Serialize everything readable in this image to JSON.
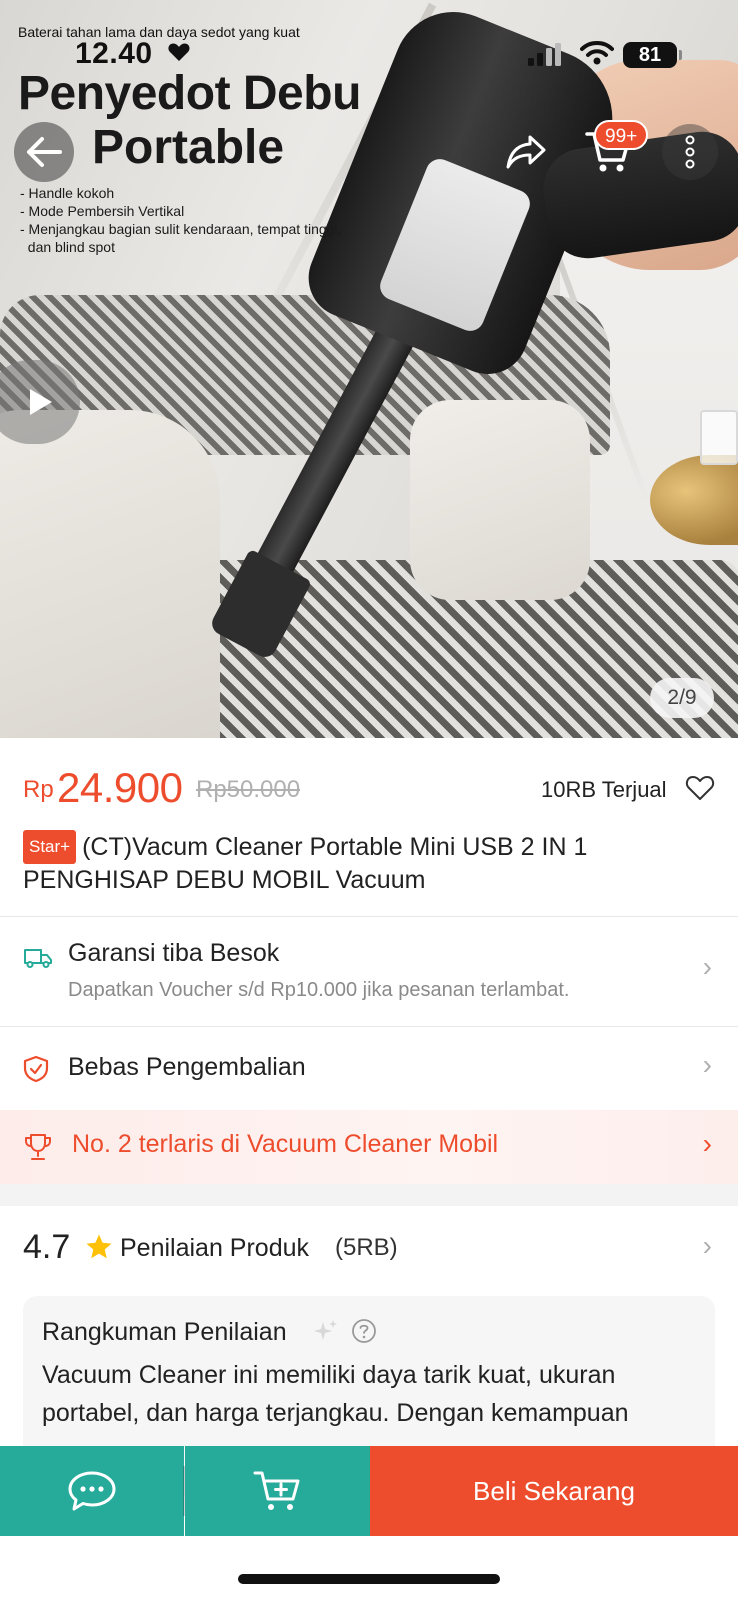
{
  "hero": {
    "promo_tagline": "Baterai tahan lama dan daya sedot yang kuat",
    "promo_title_line1": "Penyedot Debu",
    "promo_title_line2": "Portable",
    "promo_features": [
      "- Handle kokoh",
      "- Mode Pembersih Vertikal",
      "- Menjangkau bagian sulit kendaraan, tempat tinggi,",
      "  dan blind spot"
    ],
    "page_indicator": "2/9"
  },
  "status_bar": {
    "time": "12.40",
    "battery": "81"
  },
  "nav": {
    "cart_badge": "99+"
  },
  "product": {
    "currency": "Rp",
    "price": "24.900",
    "original_price": "Rp50.000",
    "sold": "10RB Terjual",
    "badge": "Star+",
    "title": "(CT)Vacum Cleaner Portable Mini USB 2 IN 1 PENGHISAP DEBU MOBIL Vacuum"
  },
  "shipping": {
    "title": "Garansi tiba Besok",
    "subtitle": "Dapatkan Voucher s/d Rp10.000 jika pesanan terlambat."
  },
  "returns": {
    "title": "Bebas Pengembalian"
  },
  "ranking": {
    "text": "No. 2 terlaris di Vacuum Cleaner Mobil"
  },
  "rating": {
    "score": "4.7",
    "label": "Penilaian Produk",
    "count": "(5RB)"
  },
  "review_summary": {
    "title": "Rangkuman Penilaian",
    "text": "Vacuum Cleaner ini memiliki daya tarik kuat, ukuran portabel, dan harga terjangkau. Dengan kemampuan"
  },
  "bottom_bar": {
    "buy_label": "Beli Sekarang"
  },
  "colors": {
    "brand": "#ee4d2d",
    "teal": "#26aa99"
  }
}
